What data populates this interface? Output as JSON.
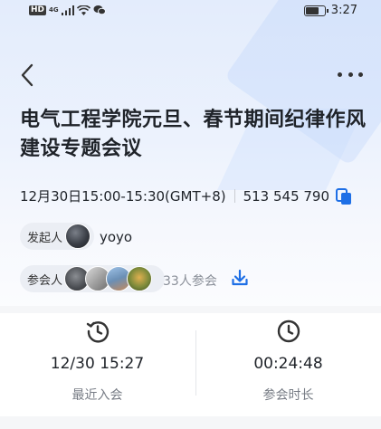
{
  "status_bar": {
    "network_label": "HD",
    "network_type": "4G",
    "time": "3:27",
    "battery_level": 0.75
  },
  "nav": {
    "back_icon": "chevron-left-icon",
    "more_icon": "more-horizontal-icon"
  },
  "meeting": {
    "title": "电气工程学院元旦、春节期间纪律作风建设专题会议",
    "time_range": "12月30日15:00-15:30(GMT+8)",
    "meeting_id": "513 545 790"
  },
  "organizer": {
    "label": "发起人",
    "name": "yoyo"
  },
  "participants": {
    "label": "参会人",
    "count_text": "33人参会"
  },
  "stats": {
    "last_join": {
      "value": "12/30 15:27",
      "label": "最近入会"
    },
    "duration": {
      "value": "00:24:48",
      "label": "参会时长"
    }
  },
  "colors": {
    "accent": "#1e6fe6",
    "title": "#1f2329",
    "muted": "#8a8f99"
  }
}
